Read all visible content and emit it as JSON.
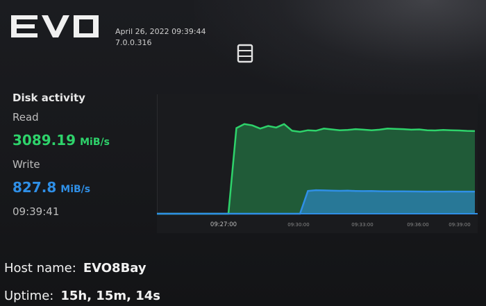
{
  "header": {
    "logo_text": "EVO",
    "date_time": "April 26, 2022 09:39:44",
    "version": "7.0.0.316"
  },
  "disk_activity": {
    "title": "Disk activity",
    "read_label": "Read",
    "read_value": "3089.19",
    "read_unit": "MiB/s",
    "write_label": "Write",
    "write_value": "827.8",
    "write_unit": "MiB/s",
    "timestamp": "09:39:41"
  },
  "chart_data": {
    "type": "area",
    "x_ticks": [
      "09:27:00",
      "09:30:00",
      "09:33:00",
      "09:36:00",
      "09:39:00"
    ],
    "series": [
      {
        "name": "Read",
        "color": "#2ed36b",
        "values": [
          0,
          0,
          0,
          0,
          0,
          0,
          0,
          0,
          0,
          0,
          3200,
          3350,
          3300,
          3180,
          3280,
          3220,
          3350,
          3100,
          3060,
          3120,
          3100,
          3180,
          3150,
          3120,
          3130,
          3160,
          3140,
          3120,
          3140,
          3180,
          3170,
          3160,
          3140,
          3150,
          3120,
          3110,
          3130,
          3120,
          3110,
          3095,
          3089
        ]
      },
      {
        "name": "Write",
        "color": "#2f8fe6",
        "values": [
          0,
          0,
          0,
          0,
          0,
          0,
          0,
          0,
          0,
          0,
          0,
          0,
          0,
          0,
          0,
          0,
          0,
          0,
          0,
          850,
          880,
          870,
          860,
          855,
          860,
          850,
          845,
          848,
          840,
          835,
          838,
          836,
          832,
          830,
          828,
          830,
          828,
          829,
          828,
          828,
          828
        ]
      }
    ],
    "ylim": [
      0,
      4200
    ]
  },
  "host": {
    "name_label": "Host name:",
    "name_value": "EVO8Bay",
    "uptime_label": "Uptime:",
    "uptime_value": "15h, 15m, 14s"
  }
}
